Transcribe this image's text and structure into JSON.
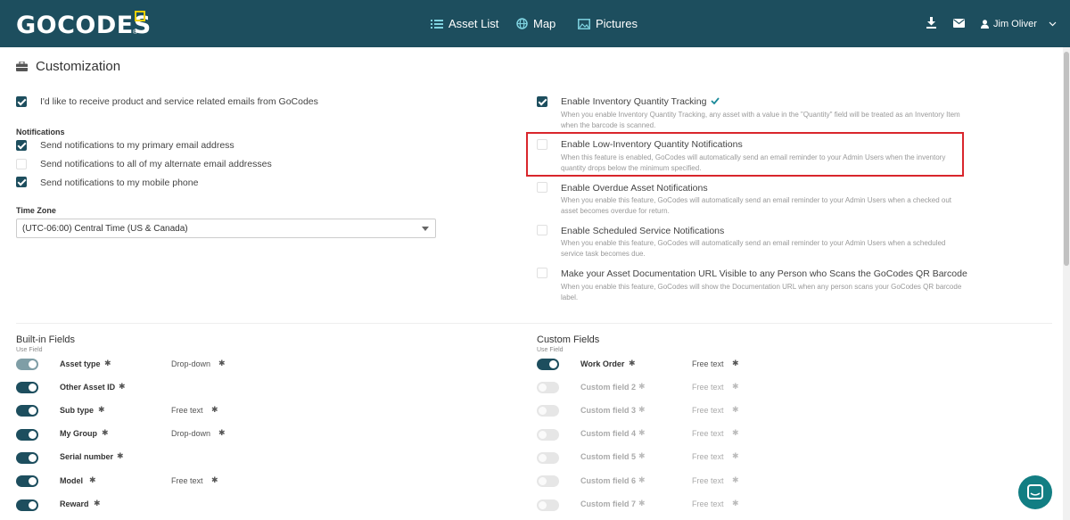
{
  "header": {
    "logo": "GOCODES",
    "nav": [
      {
        "label": "Asset List",
        "icon": "list-icon"
      },
      {
        "label": "Map",
        "icon": "globe-icon"
      },
      {
        "label": "Pictures",
        "icon": "picture-icon"
      }
    ],
    "icons": [
      "download-icon",
      "mail-icon"
    ],
    "user": "Jim Oliver"
  },
  "page": {
    "title": "Customization",
    "title_icon": "briefcase-icon"
  },
  "left_settings": {
    "marketing": {
      "label": "I'd like to receive product and service related emails from GoCodes",
      "checked": true
    },
    "notifications_heading": "Notifications",
    "notifications": [
      {
        "label": "Send notifications to my primary email address",
        "checked": true
      },
      {
        "label": "Send notifications to all of my alternate email addresses",
        "checked": false
      },
      {
        "label": "Send notifications to my mobile phone",
        "checked": true
      }
    ],
    "timezone_heading": "Time Zone",
    "timezone_value": "(UTC-06:00) Central Time (US & Canada)"
  },
  "right_settings": [
    {
      "label": "Enable Inventory Quantity Tracking",
      "checked": true,
      "confirmed": true,
      "desc": "When you enable Inventory Quantity Tracking, any asset with a value in the \"Quantity\" field will be treated as an Inventory Item when the barcode is scanned."
    },
    {
      "label": "Enable Low-Inventory Quantity Notifications",
      "checked": false,
      "highlighted": true,
      "desc": "When this feature is enabled, GoCodes will automatically send an email reminder to your Admin Users when the inventory quantity drops below the minimum specified."
    },
    {
      "label": "Enable Overdue Asset Notifications",
      "checked": false,
      "desc": "When you enable this feature, GoCodes will automatically send an email reminder to your Admin Users when a checked out asset becomes overdue for return."
    },
    {
      "label": "Enable Scheduled Service Notifications",
      "checked": false,
      "desc": "When you enable this feature, GoCodes will automatically send an email reminder to your Admin Users when a scheduled service task becomes due."
    },
    {
      "label": "Make your Asset Documentation URL Visible to any Person who Scans the GoCodes QR Barcode",
      "checked": false,
      "desc": "When you enable this feature, GoCodes will show the Documentation URL when any person scans your GoCodes QR barcode label."
    }
  ],
  "builtin": {
    "heading": "Built-in Fields",
    "use_field": "Use Field",
    "fields": [
      {
        "name": "Asset type",
        "type": "Drop-down",
        "on": true,
        "locked": true
      },
      {
        "name": "Other Asset ID",
        "type": "",
        "on": true
      },
      {
        "name": "Sub type",
        "type": "Free text",
        "on": true
      },
      {
        "name": "My Group",
        "type": "Drop-down",
        "on": true
      },
      {
        "name": "Serial number",
        "type": "",
        "on": true
      },
      {
        "name": "Model",
        "type": "Free text",
        "on": true
      },
      {
        "name": "Reward",
        "type": "",
        "on": true
      }
    ]
  },
  "custom": {
    "heading": "Custom Fields",
    "use_field": "Use Field",
    "fields": [
      {
        "name": "Work Order",
        "type": "Free text",
        "on": true
      },
      {
        "name": "Custom field 2",
        "type": "Free text",
        "on": false
      },
      {
        "name": "Custom field 3",
        "type": "Free text",
        "on": false
      },
      {
        "name": "Custom field 4",
        "type": "Free text",
        "on": false
      },
      {
        "name": "Custom field 5",
        "type": "Free text",
        "on": false
      },
      {
        "name": "Custom field 6",
        "type": "Free text",
        "on": false
      },
      {
        "name": "Custom field 7",
        "type": "Free text",
        "on": false
      }
    ]
  },
  "colors": {
    "brand": "#1d4e5e",
    "highlight": "#d9262c",
    "chat": "#127e83"
  }
}
